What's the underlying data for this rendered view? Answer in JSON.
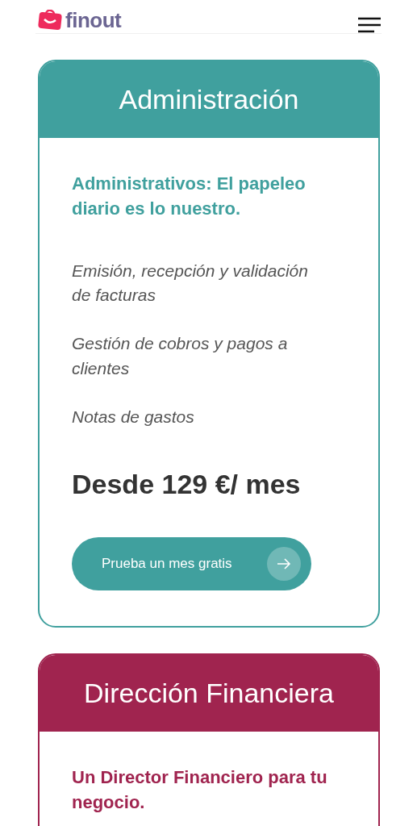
{
  "header": {
    "logo": "finout"
  },
  "plans": [
    {
      "title": "Administración",
      "color": "#40a09e",
      "tagline": "Administrativos: El papeleo diario es lo nuestro.",
      "features": [
        "Emisión, recepción y validación de facturas",
        "Gestión de cobros y pagos a clientes",
        "Notas de gastos"
      ],
      "price": "Desde 129 €/ mes",
      "cta": "Prueba un mes gratis"
    },
    {
      "title": "Dirección Financiera",
      "color": "#a0244f",
      "tagline": "Un Director Financiero para tu negocio."
    }
  ]
}
